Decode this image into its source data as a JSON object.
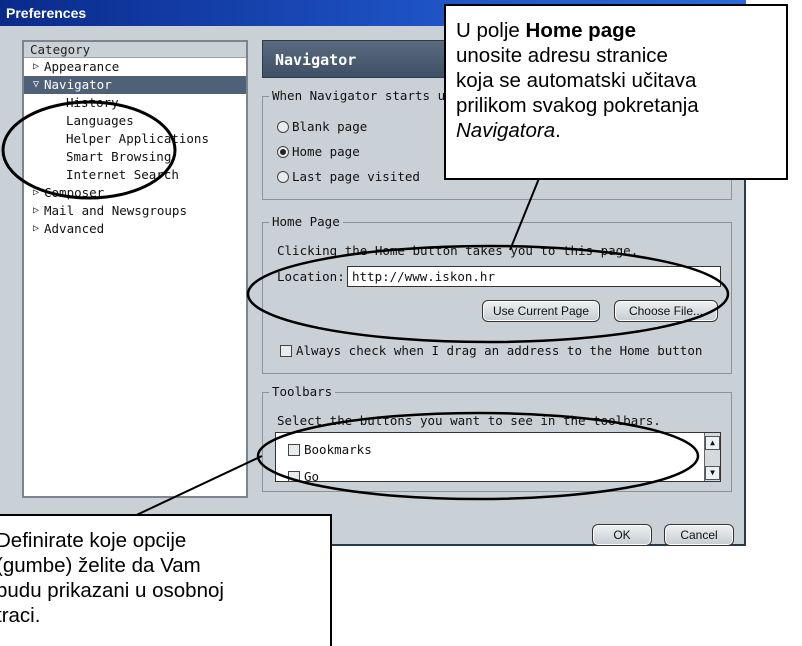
{
  "window": {
    "title": "Preferences"
  },
  "category": {
    "header": "Category",
    "items": [
      {
        "label": "Appearance",
        "twisty": "▷"
      },
      {
        "label": "Navigator",
        "twisty": "▽"
      },
      {
        "label": "History"
      },
      {
        "label": "Languages"
      },
      {
        "label": "Helper Applications"
      },
      {
        "label": "Smart Browsing"
      },
      {
        "label": "Internet Search"
      },
      {
        "label": "Composer",
        "twisty": "▷"
      },
      {
        "label": "Mail and Newsgroups",
        "twisty": "▷"
      },
      {
        "label": "Advanced",
        "twisty": "▷"
      }
    ]
  },
  "panel": {
    "title": "Navigator"
  },
  "startup": {
    "legend": "When Navigator starts u",
    "options": [
      "Blank page",
      "Home page",
      "Last page visited"
    ],
    "selected": "Home page"
  },
  "home_page": {
    "legend": "Home Page",
    "description": "Clicking the Home button takes you to this page.",
    "location_label": "Location:",
    "location_value": "http://www.iskon.hr",
    "use_current_label": "Use Current Page",
    "choose_file_label": "Choose File...",
    "always_check_label": "Always check when I drag an address to the Home button"
  },
  "toolbars": {
    "legend": "Toolbars",
    "description": "Select the buttons you want to see in the toolbars.",
    "items": [
      "Bookmarks",
      "Go"
    ]
  },
  "buttons": {
    "ok": "OK",
    "cancel": "Cancel"
  },
  "callout_top": {
    "line1_pre": "U polje ",
    "line1_bold": "Home page",
    "line2": "unosite adresu stranice",
    "line3": "koja se automatski učitava",
    "line4": "prilikom svakog pokretanja",
    "line5_italic": "Navigatora",
    "line5_post": "."
  },
  "callout_bottom": {
    "line1": "Definirate koje opcije",
    "line2": "(gumbe) želite da Vam",
    "line3": "budu prikazani u osobnoj",
    "line4": "traci."
  }
}
